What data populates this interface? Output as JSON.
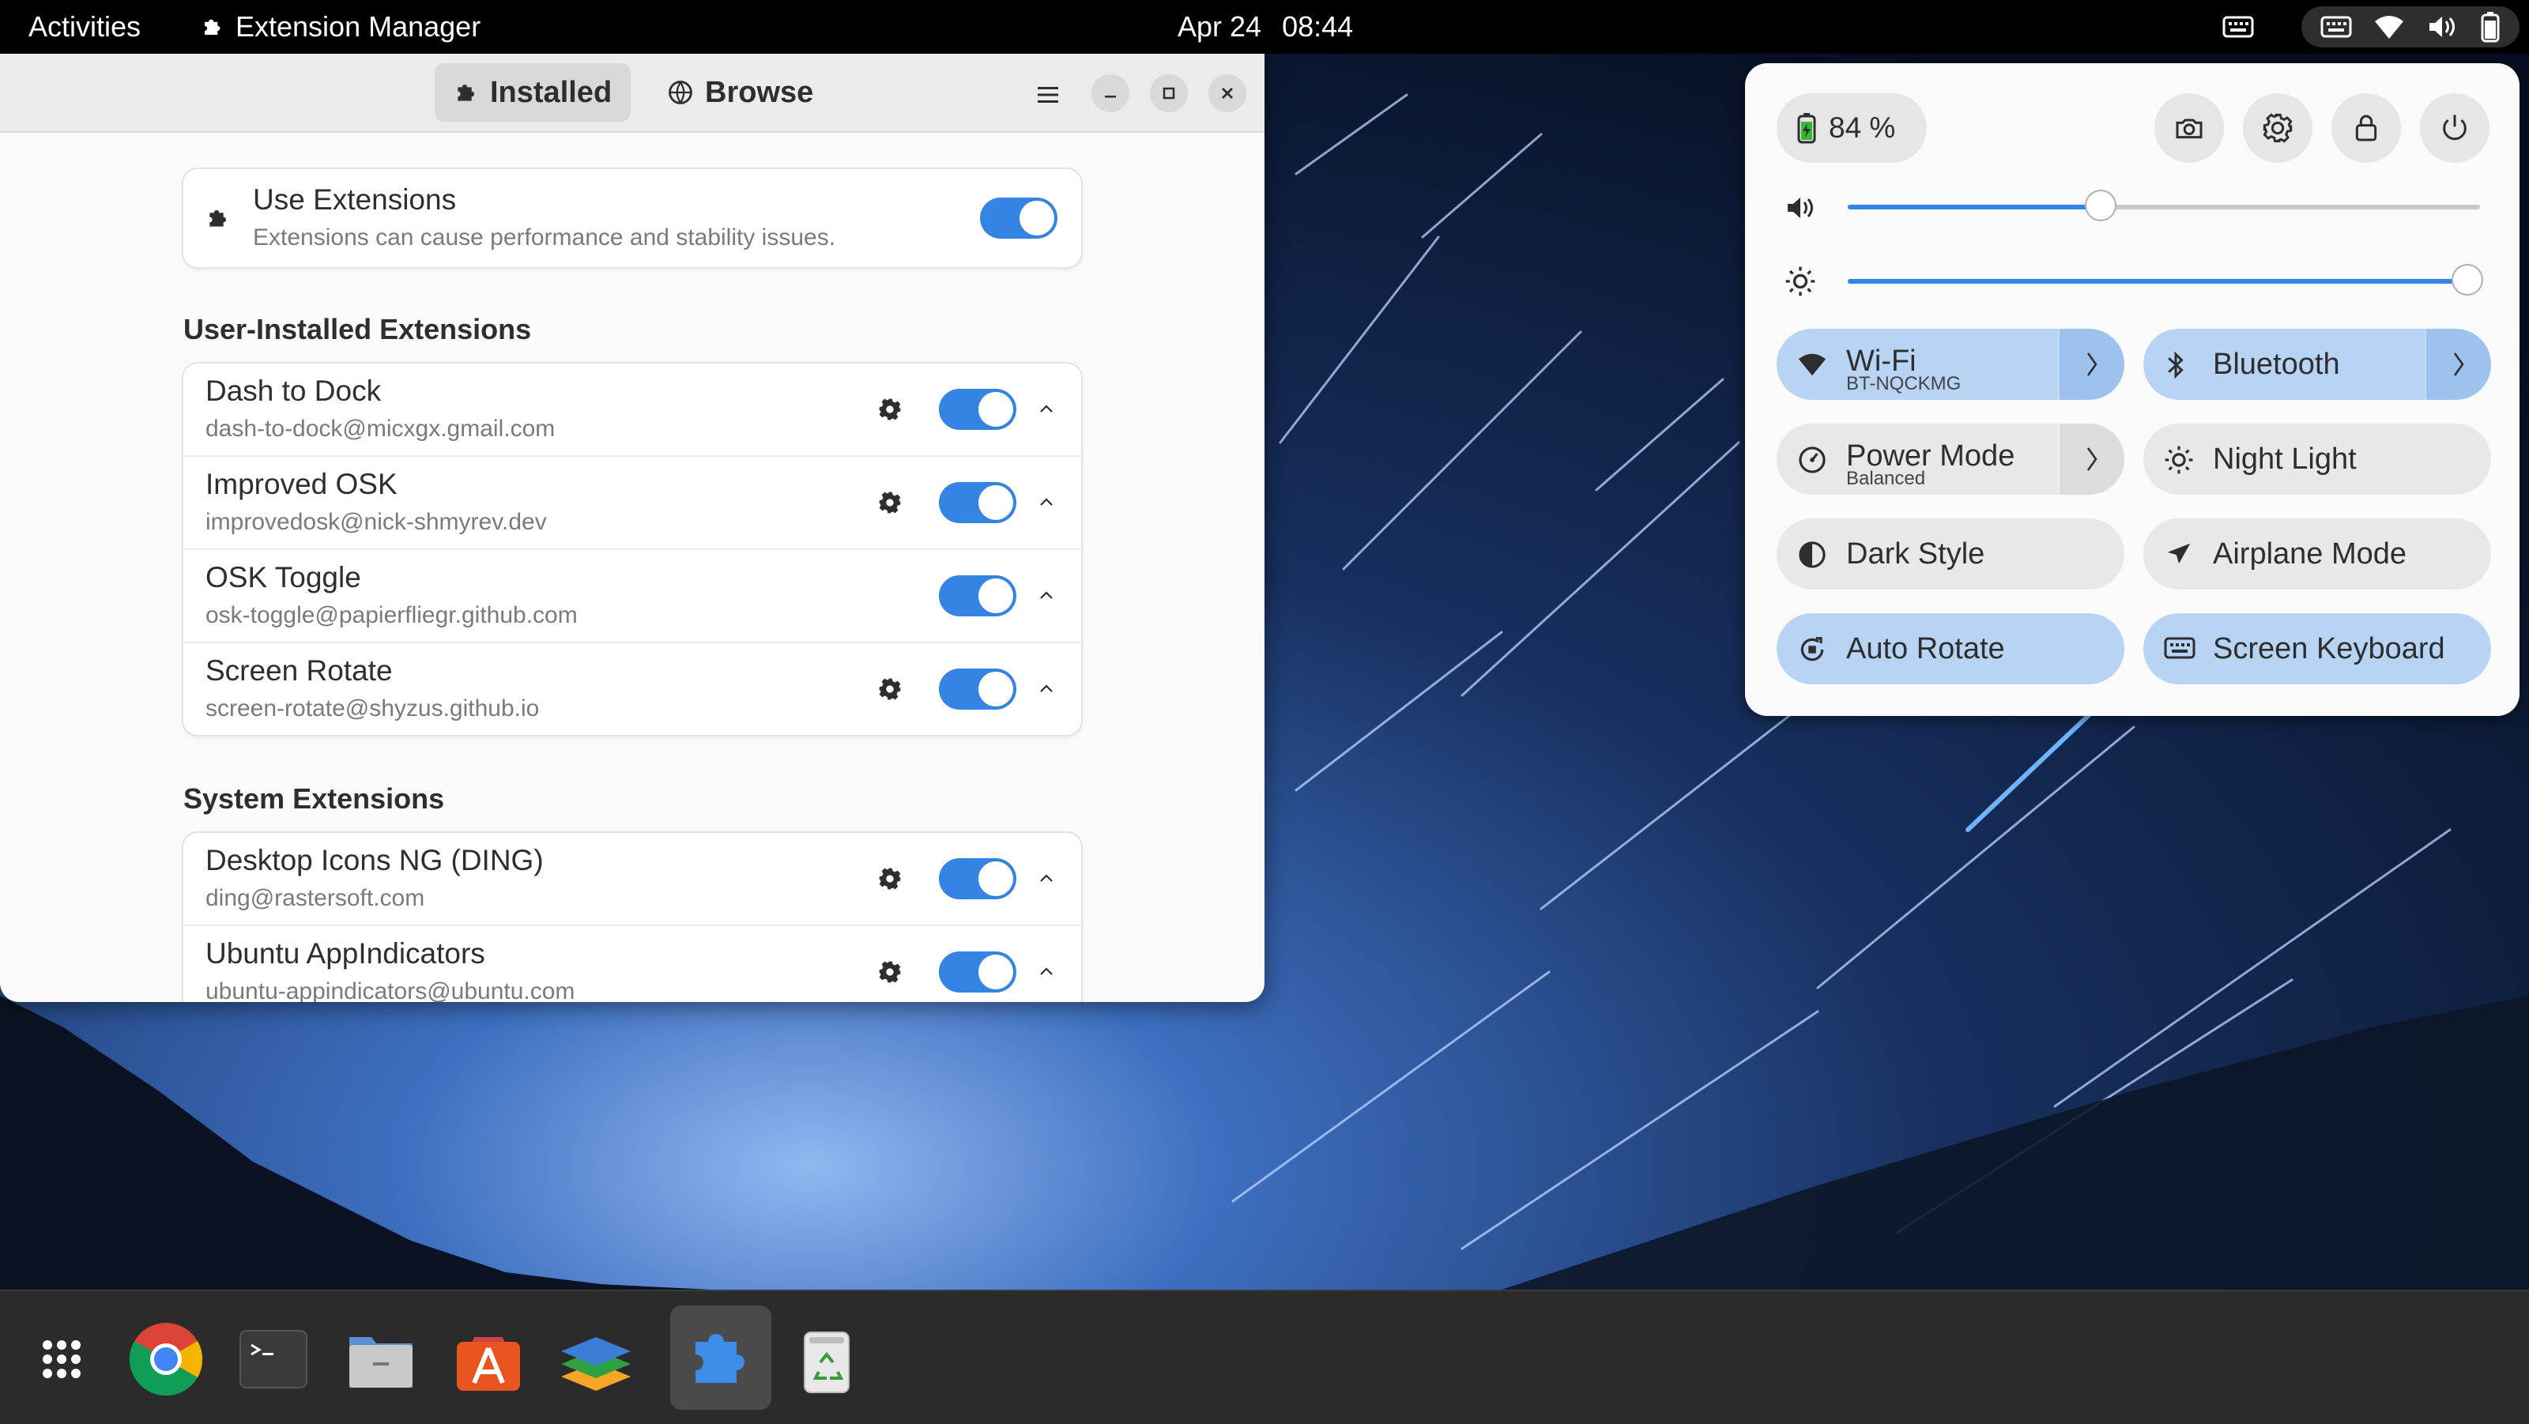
{
  "topbar": {
    "activities": "Activities",
    "app_name": "Extension Manager",
    "date": "Apr 24",
    "time": "08:44"
  },
  "window": {
    "tabs": {
      "installed": "Installed",
      "browse": "Browse"
    },
    "use_extensions": {
      "title": "Use Extensions",
      "subtitle": "Extensions can cause performance and stability issues.",
      "enabled": true
    },
    "user_section_title": "User-Installed Extensions",
    "user_extensions": [
      {
        "name": "Dash to Dock",
        "id": "dash-to-dock@micxgx.gmail.com",
        "has_settings": true,
        "enabled": true
      },
      {
        "name": "Improved OSK",
        "id": "improvedosk@nick-shmyrev.dev",
        "has_settings": true,
        "enabled": true
      },
      {
        "name": "OSK Toggle",
        "id": "osk-toggle@papierfliegr.github.com",
        "has_settings": false,
        "enabled": true
      },
      {
        "name": "Screen Rotate",
        "id": "screen-rotate@shyzus.github.io",
        "has_settings": true,
        "enabled": true
      }
    ],
    "system_section_title": "System Extensions",
    "system_extensions": [
      {
        "name": "Desktop Icons NG (DING)",
        "id": "ding@rastersoft.com",
        "has_settings": true,
        "enabled": true
      },
      {
        "name": "Ubuntu AppIndicators",
        "id": "ubuntu-appindicators@ubuntu.com",
        "has_settings": true,
        "enabled": true
      }
    ]
  },
  "quick_settings": {
    "battery": "84 %",
    "volume_level": 0.4,
    "brightness_level": 0.98,
    "toggles": {
      "wifi": {
        "label": "Wi-Fi",
        "sub": "BT-NQCKMG",
        "on": true
      },
      "bluetooth": {
        "label": "Bluetooth",
        "on": true
      },
      "power_mode": {
        "label": "Power Mode",
        "sub": "Balanced",
        "on": false
      },
      "night_light": {
        "label": "Night Light",
        "on": false
      },
      "dark_style": {
        "label": "Dark Style",
        "on": false
      },
      "airplane": {
        "label": "Airplane Mode",
        "on": false
      },
      "auto_rotate": {
        "label": "Auto Rotate",
        "on": true
      },
      "screen_keyboard": {
        "label": "Screen Keyboard",
        "on": true
      }
    }
  },
  "dock": {
    "icons": [
      "apps-grid-icon",
      "chrome-icon",
      "terminal-icon",
      "files-icon",
      "app-center-icon",
      "layers-app-icon",
      "extension-manager-icon",
      "trash-icon"
    ]
  },
  "colors": {
    "accent": "#3584e4",
    "toggle_on": "#b7d4f5",
    "panel": "#fafafa"
  }
}
